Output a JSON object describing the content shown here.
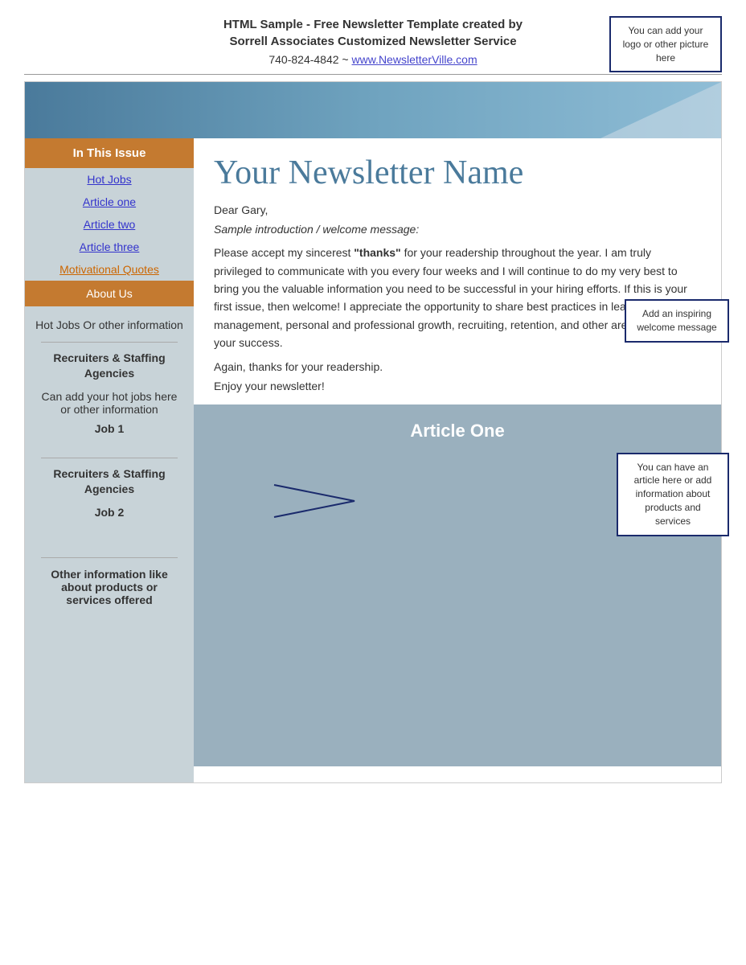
{
  "header": {
    "title_line1": "HTML Sample - Free Newsletter Template created by",
    "title_line2": "Sorrell Associates Customized Newsletter Service",
    "contact": "740-824-4842 ~ ",
    "website_text": "www.NewsletterVille.com",
    "website_url": "#"
  },
  "logo_annotation": {
    "text": "You can add your logo or other picture here"
  },
  "banner": {},
  "sidebar": {
    "in_this_issue": "In This Issue",
    "nav_links": [
      {
        "label": "Hot Jobs",
        "id": "hot-jobs-link"
      },
      {
        "label": "Article one",
        "id": "article-one-link"
      },
      {
        "label": "Article two",
        "id": "article-two-link"
      },
      {
        "label": "Article three",
        "id": "article-three-link"
      }
    ],
    "motivational_label": "Motivational Quotes",
    "about_us": "About Us",
    "hot_jobs_title": "Hot Jobs Or other information",
    "recruiters_1": "Recruiters & Staffing Agencies",
    "hot_jobs_desc": "Can add your hot jobs here or other information",
    "job1": "Job 1",
    "recruiters_2": "Recruiters & Staffing Agencies",
    "job2": "Job 2",
    "other_info": "Other information like about products or services offered"
  },
  "main": {
    "newsletter_name": "Your Newsletter Name",
    "dear_line": "Dear Gary,",
    "intro_italic": "Sample introduction / welcome message:",
    "body_text_1": "Please accept my sincerest ",
    "body_bold": "\"thanks\"",
    "body_text_2": " for your readership throughout the year. I am truly privileged to communicate with you every four weeks and I will continue to do my very best to bring you the valuable information you need to be successful in your hiring efforts. If this is your first issue, then welcome! I appreciate the opportunity to share best practices in leadership, management, personal and professional growth, recruiting, retention, and other areas critical to your success.",
    "thanks_line": "Again, thanks for your readership.",
    "enjoy_line": "Enjoy your newsletter!",
    "welcome_annotation": "Add an inspiring welcome message",
    "article_one_title": "Article One",
    "article_annotation": "You can have an article here or add information about products and services"
  }
}
